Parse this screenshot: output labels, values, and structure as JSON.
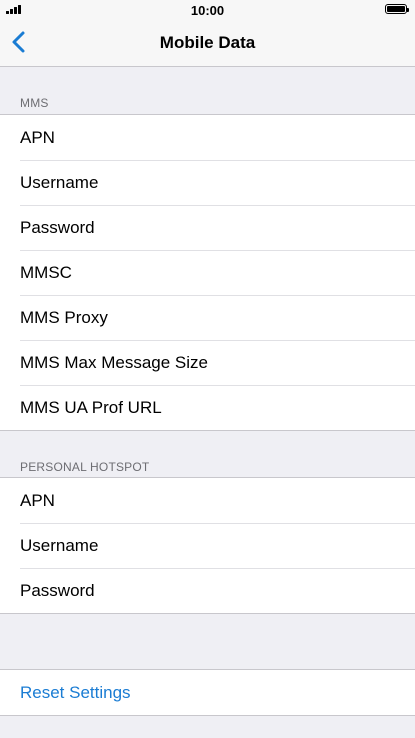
{
  "status_bar": {
    "time": "10:00"
  },
  "nav": {
    "title": "Mobile Data"
  },
  "mms": {
    "header": "MMS",
    "items": [
      "APN",
      "Username",
      "Password",
      "MMSC",
      "MMS Proxy",
      "MMS Max Message Size",
      "MMS UA Prof URL"
    ]
  },
  "hotspot": {
    "header": "PERSONAL HOTSPOT",
    "items": [
      "APN",
      "Username",
      "Password"
    ]
  },
  "reset": {
    "label": "Reset Settings"
  },
  "colors": {
    "accent": "#1a7cd3",
    "background": "#efeff4"
  }
}
